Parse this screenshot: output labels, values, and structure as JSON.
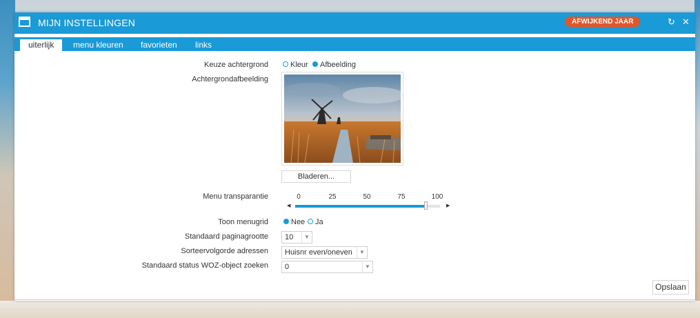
{
  "window": {
    "title": "MIJN INSTELLINGEN",
    "badge": "AFWIJKEND JAAR",
    "refresh_icon": "refresh-icon",
    "close_icon": "close-icon",
    "accent_color": "#1a9ad6",
    "badge_color": "#e3562a"
  },
  "tabs": [
    {
      "label": "uiterlijk",
      "active": true
    },
    {
      "label": "menu kleuren",
      "active": false
    },
    {
      "label": "favorieten",
      "active": false
    },
    {
      "label": "links",
      "active": false
    }
  ],
  "form": {
    "background_choice": {
      "label": "Keuze achtergrond",
      "options": [
        {
          "label": "Kleur",
          "selected": false
        },
        {
          "label": "Afbeelding",
          "selected": true
        }
      ]
    },
    "background_image": {
      "label": "Achtergrondafbeelding",
      "browse_label": "Bladeren..."
    },
    "menu_transparency": {
      "label": "Menu transparantie",
      "ticks": [
        "0",
        "25",
        "50",
        "75",
        "100"
      ],
      "value": 90
    },
    "show_menugrid": {
      "label": "Toon menugrid",
      "options": [
        {
          "label": "Nee",
          "selected": true
        },
        {
          "label": "Ja",
          "selected": false
        }
      ]
    },
    "page_size": {
      "label": "Standaard paginagrootte",
      "value": "10"
    },
    "address_sort": {
      "label": "Sorteervolgorde adressen",
      "value": "Huisnr even/oneven"
    },
    "woz_status": {
      "label": "Standaard status WOZ-object zoeken",
      "value": "0"
    }
  },
  "save_label": "Opslaan"
}
